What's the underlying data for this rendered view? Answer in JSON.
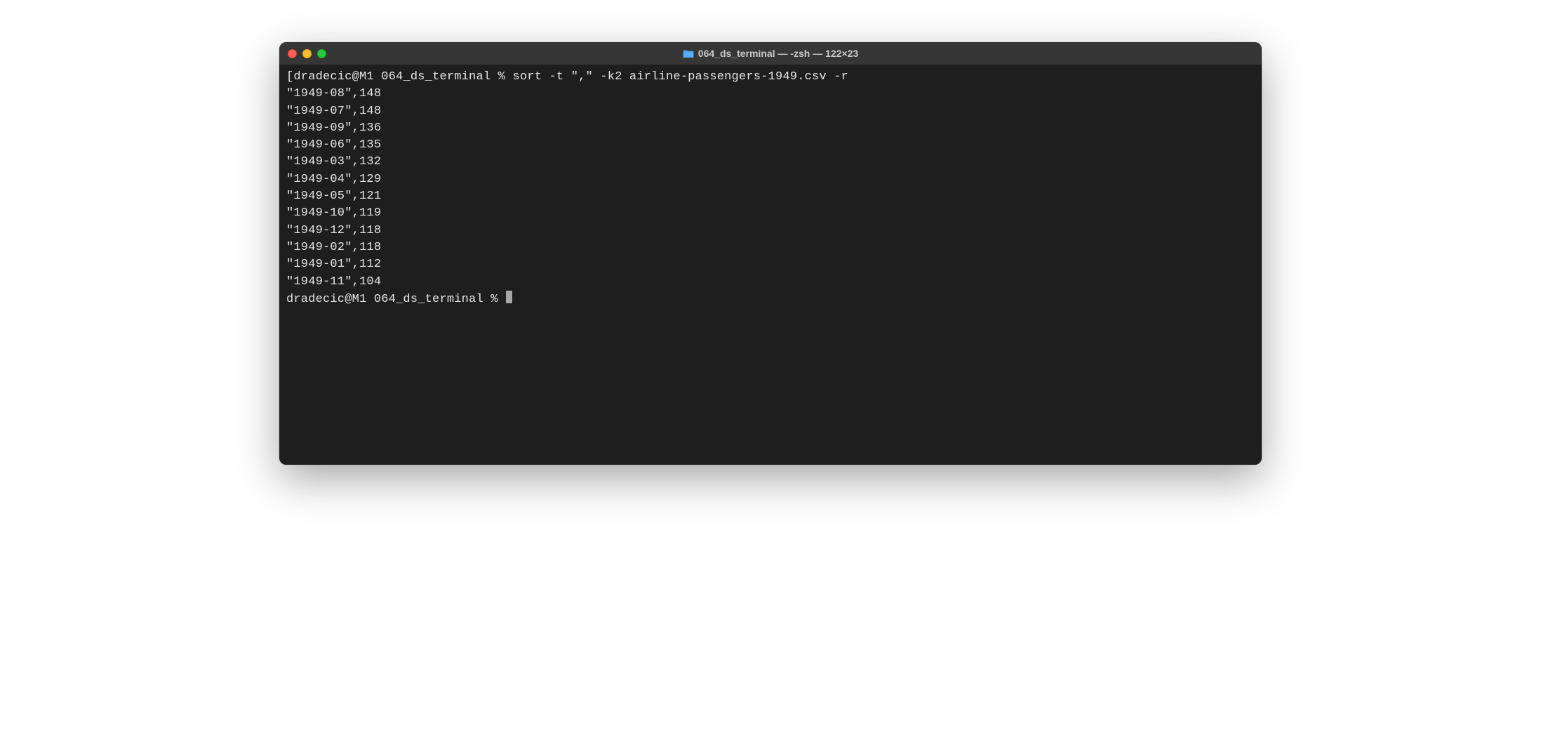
{
  "window": {
    "title": "064_ds_terminal — -zsh — 122×23"
  },
  "session": {
    "prompt1": {
      "left_bracket": "[",
      "user_host": "dradecic@M1",
      "dir": "064_ds_terminal",
      "sep": "%",
      "command": "sort -t \",\" -k2 airline-passengers-1949.csv -r",
      "right_bracket": "]"
    },
    "output": [
      "\"1949-08\",148",
      "\"1949-07\",148",
      "\"1949-09\",136",
      "\"1949-06\",135",
      "\"1949-03\",132",
      "\"1949-04\",129",
      "\"1949-05\",121",
      "\"1949-10\",119",
      "\"1949-12\",118",
      "\"1949-02\",118",
      "\"1949-01\",112",
      "\"1949-11\",104"
    ],
    "prompt2": {
      "user_host": "dradecic@M1",
      "dir": "064_ds_terminal",
      "sep": "%"
    }
  }
}
